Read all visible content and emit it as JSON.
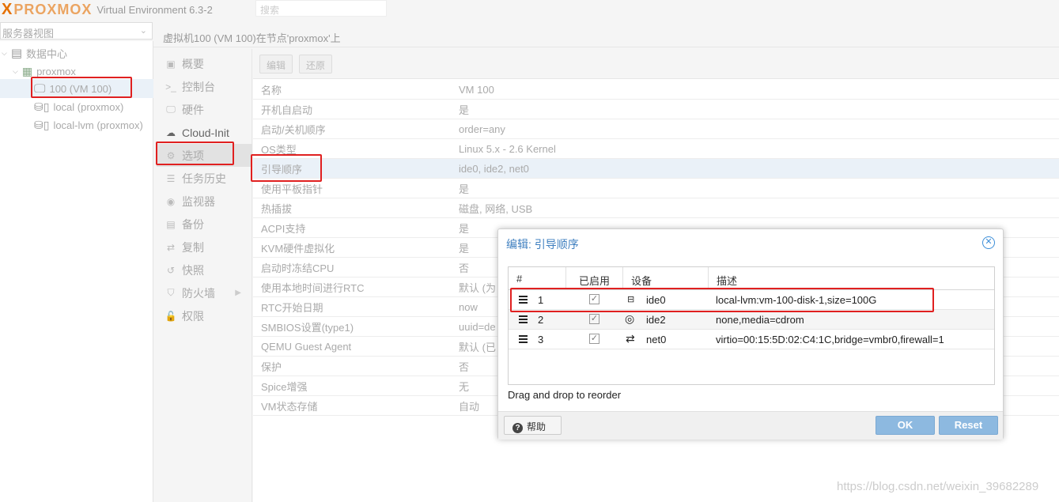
{
  "app": {
    "brand_x": "X",
    "brand_name": "PROXMOX",
    "version": "Virtual Environment 6.3-2",
    "search_placeholder": "搜索"
  },
  "view_selector": "服务器视图",
  "tree": [
    {
      "label": "数据中心",
      "icon": "datacenter-icon"
    },
    {
      "label": "proxmox",
      "icon": "node-icon"
    },
    {
      "label": "100 (VM 100)",
      "icon": "vm-running-icon"
    },
    {
      "label": "local (proxmox)",
      "icon": "storage-icon"
    },
    {
      "label": "local-lvm (proxmox)",
      "icon": "storage-icon"
    }
  ],
  "header_title": "虚拟机100 (VM 100)在节点'proxmox'上",
  "menu": [
    {
      "label": "概要",
      "icon": "summary-icon"
    },
    {
      "label": "控制台",
      "icon": "console-icon"
    },
    {
      "label": "硬件",
      "icon": "hardware-icon"
    },
    {
      "label": "Cloud-Init",
      "icon": "cloud-icon"
    },
    {
      "label": "选项",
      "icon": "gear-icon"
    },
    {
      "label": "任务历史",
      "icon": "list-icon"
    },
    {
      "label": "监视器",
      "icon": "eye-icon"
    },
    {
      "label": "备份",
      "icon": "floppy-icon"
    },
    {
      "label": "复制",
      "icon": "retweet-icon"
    },
    {
      "label": "快照",
      "icon": "history-icon"
    },
    {
      "label": "防火墙",
      "icon": "shield-icon"
    },
    {
      "label": "权限",
      "icon": "unlock-icon"
    }
  ],
  "toolbar": {
    "edit": "编辑",
    "revert": "还原"
  },
  "options": [
    {
      "k": "名称",
      "v": "VM 100"
    },
    {
      "k": "开机自启动",
      "v": "是"
    },
    {
      "k": "启动/关机顺序",
      "v": "order=any"
    },
    {
      "k": "OS类型",
      "v": "Linux 5.x - 2.6 Kernel"
    },
    {
      "k": "引导顺序",
      "v": "ide0, ide2, net0"
    },
    {
      "k": "使用平板指针",
      "v": "是"
    },
    {
      "k": "热插拔",
      "v": "磁盘, 网络, USB"
    },
    {
      "k": "ACPI支持",
      "v": "是"
    },
    {
      "k": "KVM硬件虚拟化",
      "v": "是"
    },
    {
      "k": "启动时冻结CPU",
      "v": "否"
    },
    {
      "k": "使用本地时间进行RTC",
      "v": "默认 (为"
    },
    {
      "k": "RTC开始日期",
      "v": "now"
    },
    {
      "k": "SMBIOS设置(type1)",
      "v": "uuid=de"
    },
    {
      "k": "QEMU Guest Agent",
      "v": "默认 (已"
    },
    {
      "k": "保护",
      "v": "否"
    },
    {
      "k": "Spice增强",
      "v": "无"
    },
    {
      "k": "VM状态存储",
      "v": "自动"
    }
  ],
  "dialog": {
    "title": "编辑: 引导顺序",
    "columns": [
      "#",
      "已启用",
      "设备",
      "描述"
    ],
    "rows": [
      {
        "n": "1",
        "enabled": "✓",
        "device_icon": "hdd-icon",
        "device": "ide0",
        "desc": "local-lvm:vm-100-disk-1,size=100G"
      },
      {
        "n": "2",
        "enabled": "✓",
        "device_icon": "cdrom-icon",
        "device": "ide2",
        "desc": "none,media=cdrom"
      },
      {
        "n": "3",
        "enabled": "✓",
        "device_icon": "network-icon",
        "device": "net0",
        "desc": "virtio=00:15:5D:02:C4:1C,bridge=vmbr0,firewall=1"
      }
    ],
    "hint": "Drag and drop to reorder",
    "help": "帮助",
    "ok": "OK",
    "reset": "Reset"
  },
  "watermark": "https://blog.csdn.net/weixin_39682289",
  "colors": {
    "accent": "#3c8ed8",
    "brand": "#e57000",
    "highlight": "#e02020"
  }
}
